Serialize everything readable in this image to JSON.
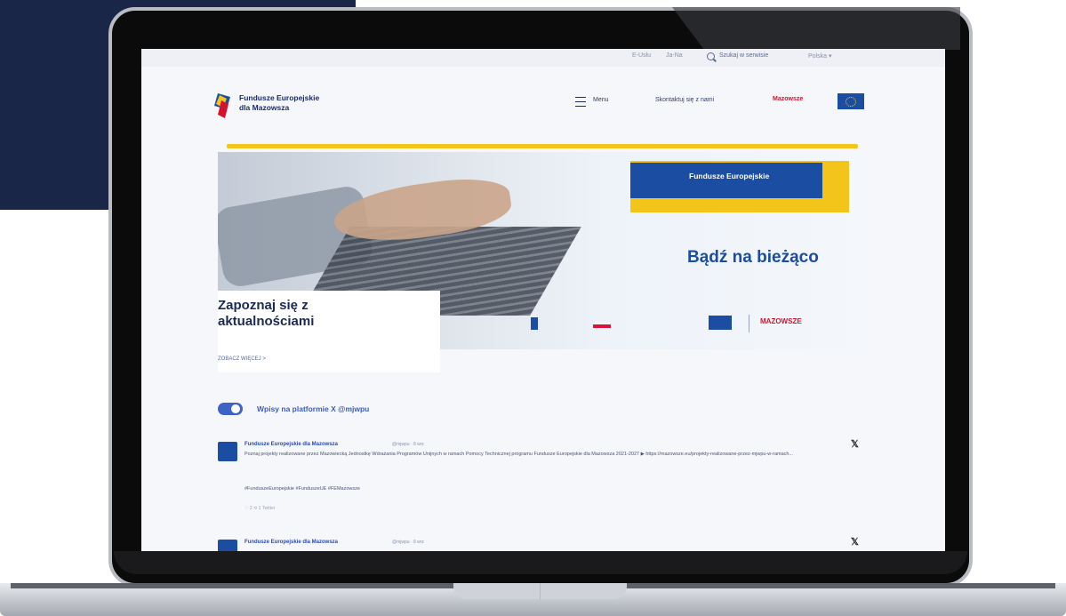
{
  "utility_bar": {
    "link_1": "E-Usłu",
    "link_2": "Ja-Na",
    "search_label": "Szukaj w serwisie",
    "language": "Polska ▾"
  },
  "header": {
    "logo_line_1": "Fundusze Europejskie",
    "logo_line_2": "dla Mazowsza",
    "menu_label": "Menu",
    "contact_label": "Skontaktuj się z nami",
    "region_logo": "Mazowsze"
  },
  "hero": {
    "banner_text": "Fundusze Europejskie",
    "title": "Bądź na bieżąco",
    "strip_region_logo": "MAZOWSZE"
  },
  "news_card": {
    "title_line_1": "Zapoznaj się z",
    "title_line_2": "aktualnościami",
    "link": "ZOBACZ WIĘCEJ  >"
  },
  "feed": {
    "toggle_label": "Wpisy na platformie X @mjwpu",
    "posts": [
      {
        "author": "Fundusze Europejskie dla Mazowsza",
        "meta": "@mjwpu · 8 wrz",
        "body": "Poznaj projekty realizowane przez Mazowiecką Jednostkę Wdrażania Programów Unijnych w ramach Pomocy Technicznej programu Fundusze Europejskie dla Mazowsza 2021-2027 ▶ https://mazowsze.eu/projekty-realizowane-przez-mjwpu-w-ramach...",
        "tags": "#FunduszeEuropejskie #FunduszeUE #FEMazowsze",
        "actions": "♡ 2   ⟲ 1   Twitter"
      },
      {
        "author": "Fundusze Europejskie dla Mazowsza",
        "meta": "@mjwpu · 8 wrz"
      }
    ]
  },
  "colors": {
    "navy": "#1a2647",
    "brand_blue": "#1b4da3",
    "accent_yellow": "#f3c419",
    "region_red": "#d3132d"
  }
}
